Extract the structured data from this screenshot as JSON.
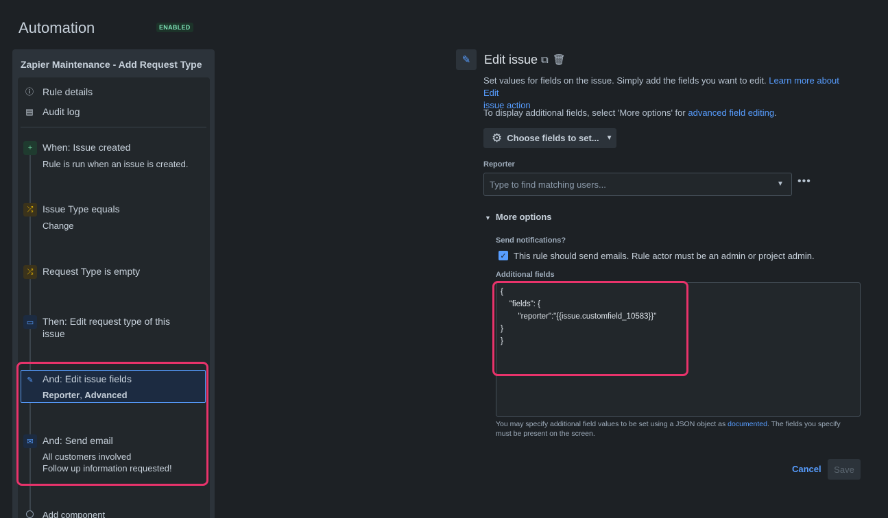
{
  "header": {
    "title": "Automation",
    "badge": "ENABLED"
  },
  "sidebar": {
    "rule_name": "Zapier Maintenance - Add Request Type",
    "menu": [
      {
        "label": "Rule details",
        "icon": "info-icon"
      },
      {
        "label": "Audit log",
        "icon": "document-icon"
      }
    ],
    "steps": [
      {
        "title": "When: Issue created",
        "desc1": "Rule is run when an issue is created.",
        "icon": "plus-icon"
      },
      {
        "title": "Issue Type equals",
        "desc1": "Change",
        "icon": "shuffle-icon"
      },
      {
        "title": "Request Type is empty",
        "icon": "shuffle-icon"
      },
      {
        "title": "Then: Edit request type of this",
        "title2": "issue",
        "icon": "request-icon"
      },
      {
        "title": "And: Edit issue fields",
        "desc_bold1": "Reporter",
        "desc_sep": ", ",
        "desc_bold2": "Advanced",
        "icon": "pencil-icon"
      },
      {
        "title": "And: Send email",
        "desc1": "All customers involved",
        "desc2": "Follow up information requested!",
        "icon": "mail-icon"
      }
    ],
    "add_component": "Add component"
  },
  "editor": {
    "title": "Edit issue",
    "desc_line1": "Set values for fields on the issue. Simply add the fields you want to edit.",
    "learn_more_a": "Learn more about Edit",
    "learn_more_b": "issue action",
    "display_text": "To display additional fields, select 'More options' for",
    "advanced_link": "advanced field editing",
    "period": ".",
    "choose_fields": "Choose fields to set...",
    "reporter_label": "Reporter",
    "reporter_placeholder": "Type to find matching users...",
    "more_options": "More options",
    "send_notifications_label": "Send notifications?",
    "checkbox_label": "This rule should send emails. Rule actor must be an admin or project admin.",
    "checkbox_checked": true,
    "additional_fields_label": "Additional fields",
    "json_lines": [
      "{",
      "    \"fields\": {",
      "        \"reporter\":\"{{issue.customfield_10583}}\"",
      "}",
      "}"
    ],
    "help_a": "You may specify additional field values to be set using a JSON object as",
    "help_link": "documented",
    "help_b": ". The fields you specify",
    "help_c": "must be present on the screen.",
    "cancel": "Cancel",
    "save": "Save"
  },
  "colors": {
    "accent": "#579dff",
    "highlight": "#e8336b",
    "background": "#1d2125"
  }
}
